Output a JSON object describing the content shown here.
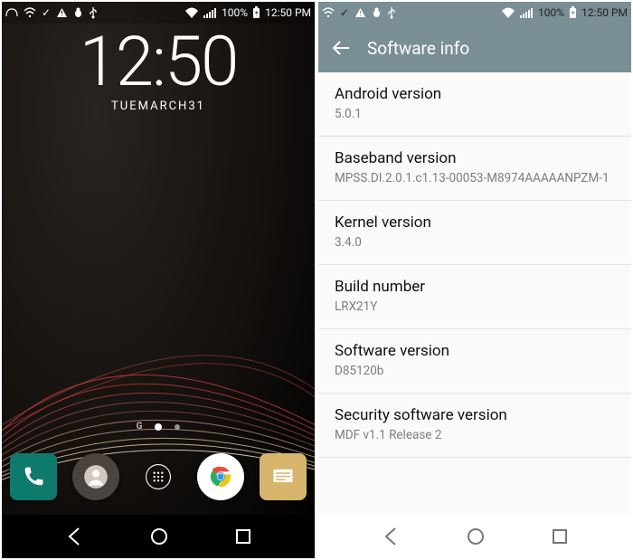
{
  "status": {
    "time": "12:50 PM",
    "battery": "100%"
  },
  "clock": {
    "time": "12:50",
    "date": "TUEMARCH31"
  },
  "pager": {
    "g_label": "G"
  },
  "settings": {
    "screen_title": "Software info",
    "rows": [
      {
        "title": "Android version",
        "value": "5.0.1"
      },
      {
        "title": "Baseband version",
        "value": "MPSS.DI.2.0.1.c1.13-00053-M8974AAAAANPZM-1"
      },
      {
        "title": "Kernel version",
        "value": "3.4.0"
      },
      {
        "title": "Build number",
        "value": "LRX21Y"
      },
      {
        "title": "Software version",
        "value": "D85120b"
      },
      {
        "title": "Security software version",
        "value": "MDF v1.1 Release 2"
      }
    ]
  }
}
